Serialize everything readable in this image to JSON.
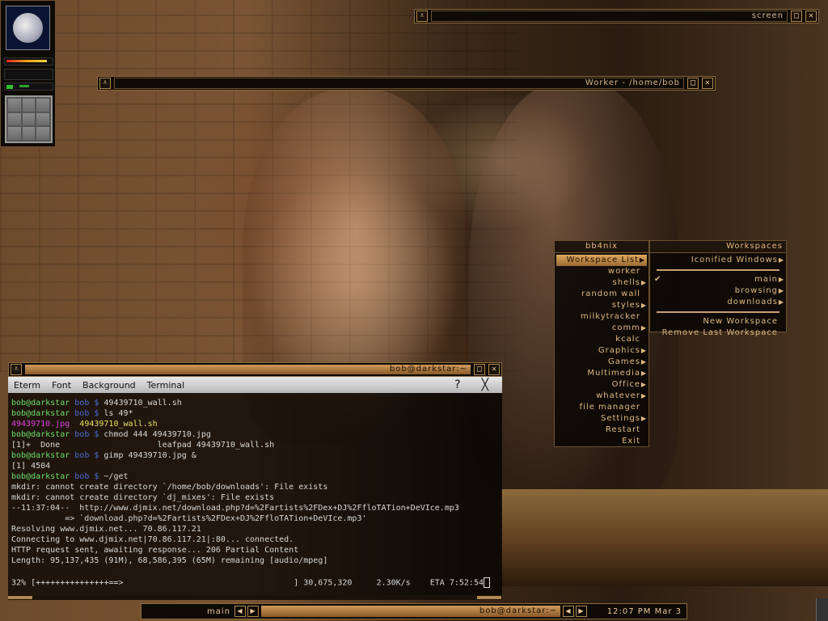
{
  "desktop": {
    "dock": {
      "moon_label": "moon phase"
    },
    "screen_window": {
      "title": "screen"
    },
    "worker_window": {
      "title": "Worker - /home/bob"
    }
  },
  "terminal": {
    "title": "bob@darkstar:~",
    "menu": [
      "Eterm",
      "Font",
      "Background",
      "Terminal"
    ],
    "help_glyph": "?",
    "close_glyph": "╳",
    "lines": [
      [
        {
          "c": "c-green",
          "t": "bob@darkstar "
        },
        {
          "c": "c-blue",
          "t": "bob $ "
        },
        {
          "c": "",
          "t": "49439710_wall.sh"
        }
      ],
      [
        {
          "c": "c-green",
          "t": "bob@darkstar "
        },
        {
          "c": "c-blue",
          "t": "bob $ "
        },
        {
          "c": "",
          "t": "ls 49*"
        }
      ],
      [
        {
          "c": "c-mag",
          "t": "49439710.jpg"
        },
        {
          "c": "",
          "t": "  "
        },
        {
          "c": "c-yel",
          "t": "49439710_wall.sh"
        }
      ],
      [
        {
          "c": "c-green",
          "t": "bob@darkstar "
        },
        {
          "c": "c-blue",
          "t": "bob $ "
        },
        {
          "c": "",
          "t": "chmod 444 49439710.jpg"
        }
      ],
      [
        {
          "c": "",
          "t": "[1]+  Done                    leafpad 49439710_wall.sh"
        }
      ],
      [
        {
          "c": "c-green",
          "t": "bob@darkstar "
        },
        {
          "c": "c-blue",
          "t": "bob $ "
        },
        {
          "c": "",
          "t": "gimp 49439710.jpg &"
        }
      ],
      [
        {
          "c": "",
          "t": "[1] 4504"
        }
      ],
      [
        {
          "c": "c-green",
          "t": "bob@darkstar "
        },
        {
          "c": "c-blue",
          "t": "bob $ "
        },
        {
          "c": "",
          "t": "~/get"
        }
      ],
      [
        {
          "c": "",
          "t": "mkdir: cannot create directory `/home/bob/downloads': File exists"
        }
      ],
      [
        {
          "c": "",
          "t": "mkdir: cannot create directory `dj_mixes': File exists"
        }
      ],
      [
        {
          "c": "",
          "t": "--11:37:04--  http://www.djmix.net/download.php?d=%2Fartists%2FDex+DJ%2FfloTATion+DeVIce.mp3"
        }
      ],
      [
        {
          "c": "",
          "t": "           => `download.php?d=%2Fartists%2FDex+DJ%2FfloTATion+DeVIce.mp3'"
        }
      ],
      [
        {
          "c": "",
          "t": "Resolving www.djmix.net... 70.86.117.21"
        }
      ],
      [
        {
          "c": "",
          "t": "Connecting to www.djmix.net|70.86.117.21|:80... connected."
        }
      ],
      [
        {
          "c": "",
          "t": "HTTP request sent, awaiting response... 206 Partial Content"
        }
      ],
      [
        {
          "c": "",
          "t": "Length: 95,137,435 (91M), 68,586,395 (65M) remaining [audio/mpeg]"
        }
      ]
    ],
    "progress_text": "32% [+++++++++++++++==>                                   ] 30,675,320     2.30K/s    ETA 7:52:54"
  },
  "menu": {
    "header_left": "bb4nix",
    "header_right": "Workspaces",
    "items": [
      {
        "label": "Workspace List",
        "submenu": true,
        "selected": true
      },
      {
        "label": "worker",
        "submenu": false
      },
      {
        "label": "shells",
        "submenu": true
      },
      {
        "label": "random wall",
        "submenu": false
      },
      {
        "label": "styles",
        "submenu": true
      },
      {
        "label": "milkytracker",
        "submenu": false
      },
      {
        "label": "comm",
        "submenu": true
      },
      {
        "label": "kcalc",
        "submenu": false
      },
      {
        "label": "Graphics",
        "submenu": true
      },
      {
        "label": "Games",
        "submenu": true
      },
      {
        "label": "Multimedia",
        "submenu": true
      },
      {
        "label": "Office",
        "submenu": true
      },
      {
        "label": "whatever",
        "submenu": true
      },
      {
        "label": "file manager",
        "submenu": false
      },
      {
        "label": "Settings",
        "submenu": true
      },
      {
        "label": "Restart",
        "submenu": false
      },
      {
        "label": "Exit",
        "submenu": false
      }
    ],
    "workspaces": {
      "iconified": "Iconified Windows",
      "list": [
        {
          "label": "main",
          "checked": true
        },
        {
          "label": "browsing",
          "checked": false
        },
        {
          "label": "downloads",
          "checked": false
        }
      ],
      "new": "New Workspace",
      "remove": "Remove Last Workspace"
    }
  },
  "toolbar": {
    "workspace": "main",
    "window": "bob@darkstar:~",
    "clock": "12:07 PM Mar  3",
    "prev": "◀",
    "next": "▶"
  }
}
